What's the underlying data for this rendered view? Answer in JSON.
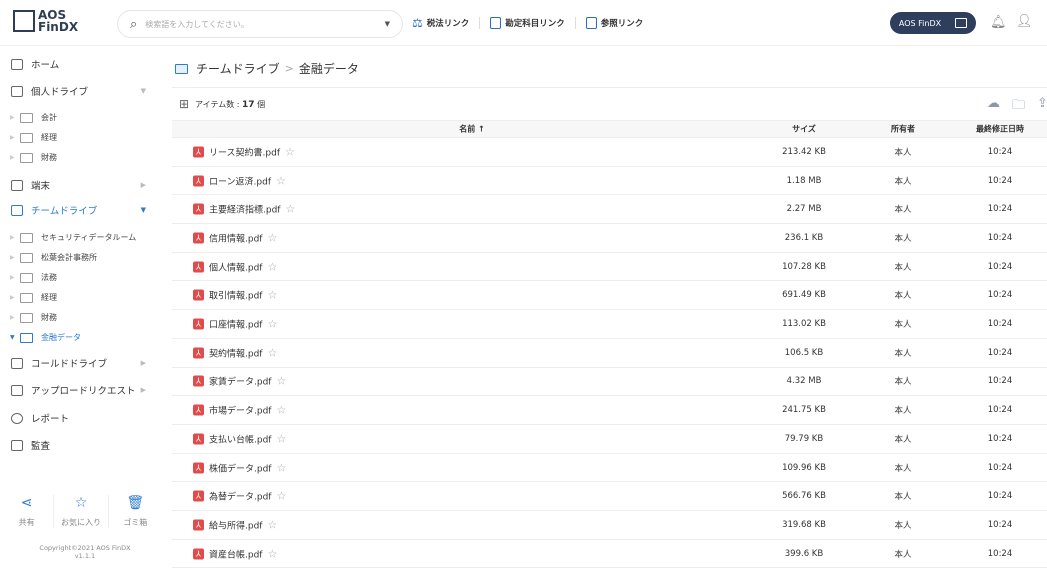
{
  "header": {
    "logo": "AOS FinDX",
    "search_placeholder": "検索語を入力してください。",
    "links": [
      "税法リンク",
      "勘定科目リンク",
      "参照リンク"
    ],
    "app_button": "AOS FinDX"
  },
  "sidebar": {
    "home": "ホーム",
    "personal": "個人ドライブ",
    "personal_children": [
      "会計",
      "経理",
      "財務"
    ],
    "device": "端末",
    "team": "チームドライブ",
    "team_children": [
      "セキュリティデータルーム",
      "松葉会計事務所",
      "法務",
      "経理",
      "財務",
      "金融データ"
    ],
    "cold": "コールドドライブ",
    "upload": "アップロードリクエスト",
    "report": "レポート",
    "audit": "監査",
    "bottom": [
      "共有",
      "お気に入り",
      "ゴミ箱"
    ],
    "copyright": "Copyright©2021 AOS FinDX",
    "version": "v1.1.1"
  },
  "breadcrumb": {
    "root": "チームドライブ",
    "current": "金融データ"
  },
  "count": {
    "label": "アイテム数 : ",
    "value": "17",
    "unit": "個"
  },
  "table": {
    "headers": {
      "name": "名前 ↑",
      "size": "サイズ",
      "owner": "所有者",
      "modified": "最終修正日時"
    },
    "rows": [
      {
        "name": "リース契約書.pdf",
        "size": "213.42 KB",
        "owner": "本人",
        "modified": "10:24"
      },
      {
        "name": "ローン返済.pdf",
        "size": "1.18 MB",
        "owner": "本人",
        "modified": "10:24"
      },
      {
        "name": "主要経済指標.pdf",
        "size": "2.27 MB",
        "owner": "本人",
        "modified": "10:24"
      },
      {
        "name": "信用情報.pdf",
        "size": "236.1 KB",
        "owner": "本人",
        "modified": "10:24"
      },
      {
        "name": "個人情報.pdf",
        "size": "107.28 KB",
        "owner": "本人",
        "modified": "10:24"
      },
      {
        "name": "取引情報.pdf",
        "size": "691.49 KB",
        "owner": "本人",
        "modified": "10:24"
      },
      {
        "name": "口座情報.pdf",
        "size": "113.02 KB",
        "owner": "本人",
        "modified": "10:24"
      },
      {
        "name": "契約情報.pdf",
        "size": "106.5 KB",
        "owner": "本人",
        "modified": "10:24"
      },
      {
        "name": "家賃データ.pdf",
        "size": "4.32 MB",
        "owner": "本人",
        "modified": "10:24"
      },
      {
        "name": "市場データ.pdf",
        "size": "241.75 KB",
        "owner": "本人",
        "modified": "10:24"
      },
      {
        "name": "支払い台帳.pdf",
        "size": "79.79 KB",
        "owner": "本人",
        "modified": "10:24"
      },
      {
        "name": "株価データ.pdf",
        "size": "109.96 KB",
        "owner": "本人",
        "modified": "10:24"
      },
      {
        "name": "為替データ.pdf",
        "size": "566.76 KB",
        "owner": "本人",
        "modified": "10:24"
      },
      {
        "name": "給与所得.pdf",
        "size": "319.68 KB",
        "owner": "本人",
        "modified": "10:24"
      },
      {
        "name": "資産台帳.pdf",
        "size": "399.6 KB",
        "owner": "本人",
        "modified": "10:24"
      }
    ]
  }
}
